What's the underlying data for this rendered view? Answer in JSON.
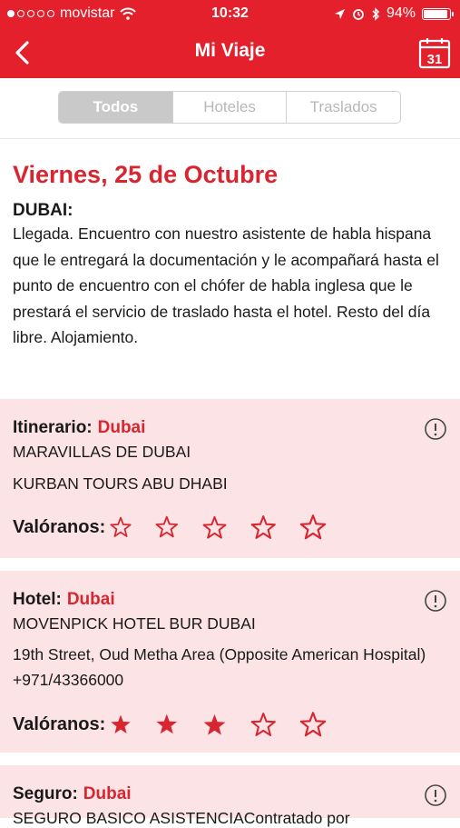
{
  "status_bar": {
    "carrier": "movistar",
    "time": "10:32",
    "battery": "94%",
    "battery_level": 0.94
  },
  "header": {
    "title": "Mi Viaje",
    "back_icon": "chevron-left-icon",
    "calendar_icon": "calendar-icon",
    "calendar_day": "31"
  },
  "tabs": [
    {
      "label": "Todos",
      "active": true
    },
    {
      "label": "Hoteles",
      "active": false
    },
    {
      "label": "Traslados",
      "active": false
    }
  ],
  "day": {
    "date": "Viernes, 25 de Octubre",
    "city": "DUBAI:",
    "description": "Llegada. Encuentro con nuestro asistente de habla hispana que le entregará la documentación y le acompañará hasta el punto de encuentro con el chófer de habla inglesa que le prestará el servicio de traslado hasta el hotel. Resto del día libre. Alojamiento."
  },
  "cards": [
    {
      "label": "Itinerario:",
      "place": "Dubai",
      "lines": [
        "MARAVILLAS DE DUBAI",
        "KURBAN TOURS ABU DHABI"
      ],
      "rating_label": "Valóranos:",
      "rating": 0,
      "max_rating": 5
    },
    {
      "label": "Hotel:",
      "place": "Dubai",
      "lines": [
        "MOVENPICK HOTEL BUR DUBAI",
        "19th Street, Oud Metha Area (Opposite American Hospital) +971/43366000"
      ],
      "rating_label": "Valóranos:",
      "rating": 3,
      "max_rating": 5
    },
    {
      "label": "Seguro:",
      "place": "Dubai",
      "lines": [
        "SEGURO BASICO ASISTENCIAContratado por"
      ]
    }
  ],
  "colors": {
    "brand_red": "#e3202c",
    "accent_red": "#d82630",
    "card_bg": "#fbe3e6"
  }
}
